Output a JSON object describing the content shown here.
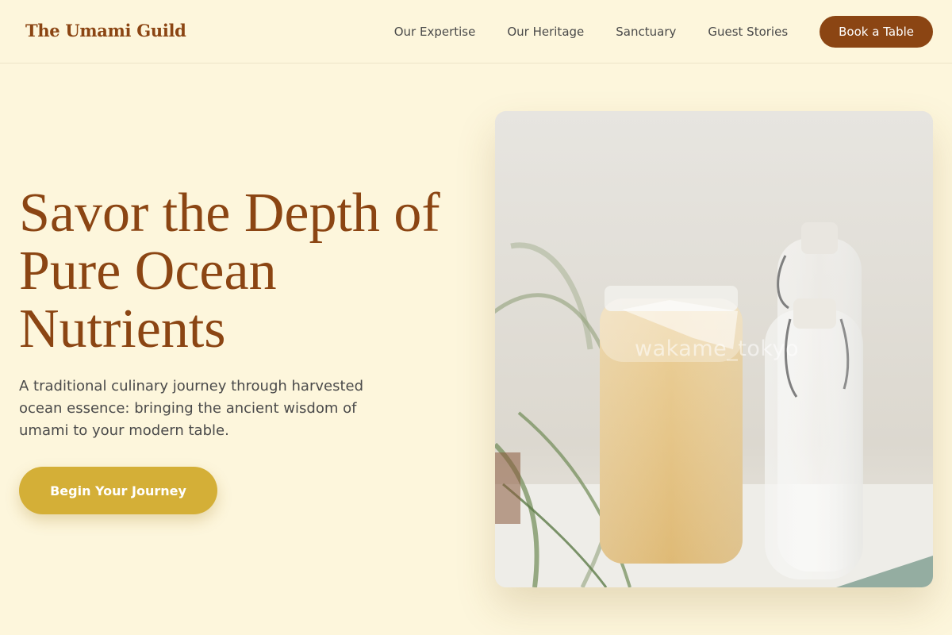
{
  "header": {
    "logo": "The Umami Guild",
    "nav": [
      {
        "label": "Our Expertise"
      },
      {
        "label": "Our Heritage"
      },
      {
        "label": "Sanctuary"
      },
      {
        "label": "Guest Stories"
      }
    ],
    "cta_label": "Book a Table"
  },
  "hero": {
    "title": "Savor the Depth of Pure Ocean Nutrients",
    "subtitle": "A traditional culinary journey through harvested ocean essence: bringing the ancient wisdom of umami to your modern table.",
    "cta_label": "Begin Your Journey",
    "image": {
      "icon": "fermentation-jars-photo",
      "watermark": "wakame_tokyo"
    }
  },
  "colors": {
    "background": "#fdf6dc",
    "brand": "#8b4513",
    "accent": "#d4af37",
    "text": "#4a4a4a"
  }
}
